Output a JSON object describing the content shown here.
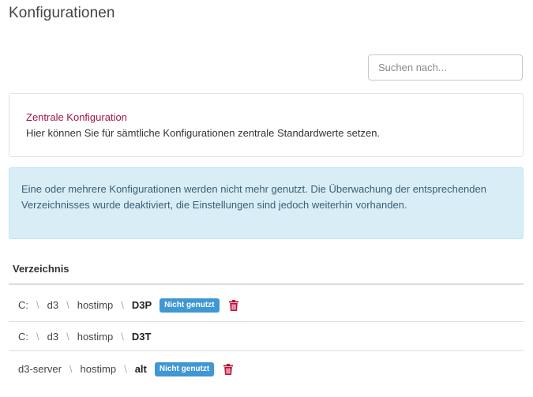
{
  "page": {
    "title": "Konfigurationen"
  },
  "search": {
    "placeholder": "Suchen nach...",
    "value": ""
  },
  "central_config": {
    "link_label": "Zentrale Konfiguration",
    "description": "Hier können Sie für sämtliche Konfigurationen zentrale Standardwerte setzen."
  },
  "alert": {
    "text": "Eine oder mehrere Konfigurationen werden nicht mehr genutzt. Die Überwachung der entsprechenden Verzeichnisses wurde deaktiviert, die Einstellungen sind jedoch weiterhin vorhanden."
  },
  "table": {
    "header": "Verzeichnis",
    "rows": [
      {
        "segments": [
          "C:",
          "d3",
          "hostimp"
        ],
        "last": "D3P",
        "badge": "Nicht genutzt",
        "deletable": true
      },
      {
        "segments": [
          "C:",
          "d3",
          "hostimp"
        ],
        "last": "D3T",
        "badge": "",
        "deletable": false
      },
      {
        "segments": [
          "d3-server",
          "hostimp"
        ],
        "last": "alt",
        "badge": "Nicht genutzt",
        "deletable": true
      }
    ]
  },
  "icons": {
    "delete": "trash-icon"
  },
  "colors": {
    "link": "#a0174a",
    "badge": "#3f97d3",
    "alert_bg": "#d9edf7",
    "delete_icon": "#c0123c"
  }
}
